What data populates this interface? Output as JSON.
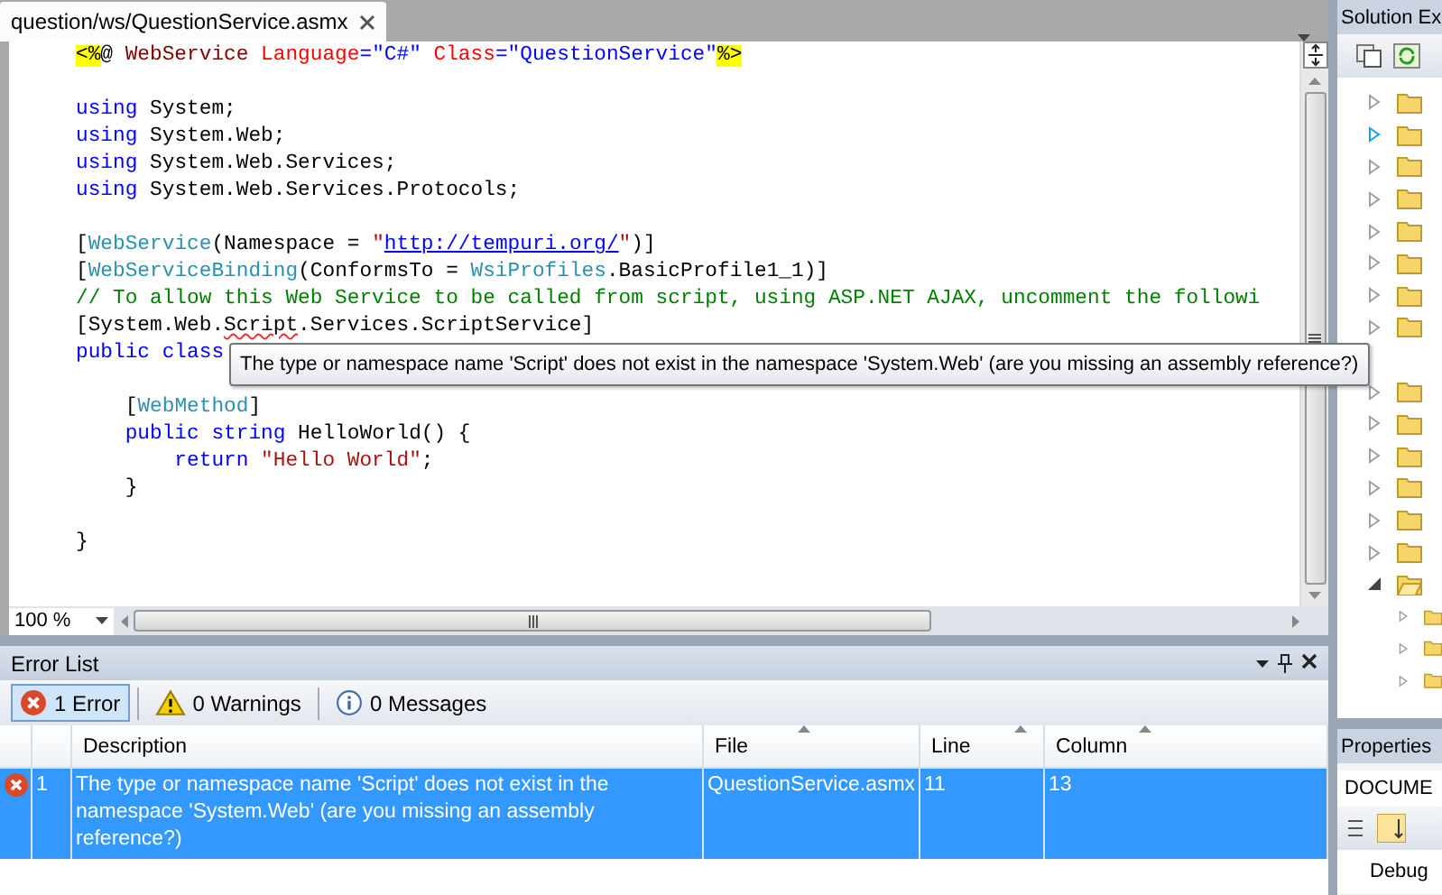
{
  "editor": {
    "tab": {
      "title": "question/ws/QuestionService.asmx",
      "selected": true
    },
    "lines": [
      {
        "kind": "code",
        "tokens": [
          {
            "kind": "hl",
            "text": "<%"
          },
          {
            "kind": "plain",
            "text": "@ "
          },
          {
            "kind": "el",
            "text": "WebService"
          },
          {
            "kind": "attr",
            "text": " Language"
          },
          {
            "kind": "val",
            "text": "=\"C#\""
          },
          {
            "kind": "attr",
            "text": " Class"
          },
          {
            "kind": "val",
            "text": "=\"QuestionService\""
          },
          {
            "kind": "hl",
            "text": "%>"
          }
        ]
      },
      {
        "kind": "blank"
      },
      {
        "kind": "code",
        "tokens": [
          {
            "kind": "kw",
            "text": "using"
          },
          {
            "kind": "plain",
            "text": " System;"
          }
        ]
      },
      {
        "kind": "code",
        "tokens": [
          {
            "kind": "kw",
            "text": "using"
          },
          {
            "kind": "plain",
            "text": " System.Web;"
          }
        ]
      },
      {
        "kind": "code",
        "tokens": [
          {
            "kind": "kw",
            "text": "using"
          },
          {
            "kind": "plain",
            "text": " System.Web.Services;"
          }
        ]
      },
      {
        "kind": "code",
        "tokens": [
          {
            "kind": "kw",
            "text": "using"
          },
          {
            "kind": "plain",
            "text": " System.Web.Services.Protocols;"
          }
        ]
      },
      {
        "kind": "blank"
      },
      {
        "kind": "code",
        "tokens": [
          {
            "kind": "plain",
            "text": "["
          },
          {
            "kind": "type",
            "text": "WebService"
          },
          {
            "kind": "plain",
            "text": "(Namespace = "
          },
          {
            "kind": "str",
            "text": "\""
          },
          {
            "kind": "link",
            "text": "http://tempuri.org/"
          },
          {
            "kind": "str",
            "text": "\""
          },
          {
            "kind": "plain",
            "text": ")]"
          }
        ]
      },
      {
        "kind": "code",
        "tokens": [
          {
            "kind": "plain",
            "text": "["
          },
          {
            "kind": "type",
            "text": "WebServiceBinding"
          },
          {
            "kind": "plain",
            "text": "(ConformsTo = "
          },
          {
            "kind": "type",
            "text": "WsiProfiles"
          },
          {
            "kind": "plain",
            "text": ".BasicProfile1_1)]"
          }
        ]
      },
      {
        "kind": "code",
        "tokens": [
          {
            "kind": "comment",
            "text": "// To allow this Web Service to be called from script, using ASP.NET AJAX, uncomment the followi"
          }
        ]
      },
      {
        "kind": "code",
        "tokens": [
          {
            "kind": "plain",
            "text": "[System.Web."
          },
          {
            "kind": "err",
            "text": "Script"
          },
          {
            "kind": "plain",
            "text": ".Services.ScriptService]"
          }
        ]
      },
      {
        "kind": "code",
        "tokens": [
          {
            "kind": "kw",
            "text": "public class"
          }
        ]
      },
      {
        "kind": "blank"
      },
      {
        "kind": "code",
        "tokens": [
          {
            "kind": "plain",
            "text": "    ["
          },
          {
            "kind": "type",
            "text": "WebMethod"
          },
          {
            "kind": "plain",
            "text": "]"
          }
        ]
      },
      {
        "kind": "code",
        "tokens": [
          {
            "kind": "kw",
            "text": "    public string"
          },
          {
            "kind": "plain",
            "text": " HelloWorld() {"
          }
        ]
      },
      {
        "kind": "code",
        "tokens": [
          {
            "kind": "kw",
            "text": "        return"
          },
          {
            "kind": "str",
            "text": " \"Hello World\""
          },
          {
            "kind": "plain",
            "text": ";"
          }
        ]
      },
      {
        "kind": "code",
        "tokens": [
          {
            "kind": "plain",
            "text": "    }"
          }
        ]
      },
      {
        "kind": "blank"
      },
      {
        "kind": "code",
        "tokens": [
          {
            "kind": "plain",
            "text": "}"
          }
        ]
      }
    ],
    "zoom": "100 %",
    "tooltip": "The type or namespace name 'Script' does not exist in the namespace 'System.Web' (are you missing an assembly reference?)"
  },
  "error_list": {
    "title": "Error List",
    "filters": [
      {
        "kind": "error",
        "label": "1 Error",
        "selected": true
      },
      {
        "kind": "warning",
        "label": "0 Warnings",
        "selected": false
      },
      {
        "kind": "info",
        "label": "0 Messages",
        "selected": false
      }
    ],
    "columns": [
      {
        "label": "Description",
        "sort_caret": false
      },
      {
        "label": "File",
        "sort_caret": true
      },
      {
        "label": "Line",
        "sort_caret": true
      },
      {
        "label": "Column",
        "sort_caret": true
      }
    ],
    "rows": [
      {
        "kind": "error",
        "number": "1",
        "description": "The type or namespace name 'Script' does not exist in the namespace 'System.Web' (are you missing an assembly reference?)",
        "file": "QuestionService.asmx",
        "line": "11",
        "column": "13",
        "selected": true
      }
    ]
  },
  "solution_explorer": {
    "title": "Solution Ex",
    "tree": [
      {
        "expanded": false,
        "hovered": false
      },
      {
        "expanded": false,
        "hovered": true
      },
      {
        "expanded": false,
        "hovered": false
      },
      {
        "expanded": false,
        "hovered": false
      },
      {
        "expanded": false,
        "hovered": false
      },
      {
        "expanded": false,
        "hovered": false
      },
      {
        "expanded": false,
        "hovered": false
      },
      {
        "expanded": false,
        "hovered": false
      },
      {
        "expanded": false,
        "hovered": false
      },
      {
        "expanded": false,
        "hovered": false
      },
      {
        "expanded": false,
        "hovered": false
      },
      {
        "expanded": false,
        "hovered": false
      },
      {
        "expanded": false,
        "hovered": false
      },
      {
        "expanded": false,
        "hovered": false
      },
      {
        "expanded": true,
        "hovered": false,
        "children": [
          {
            "expanded": false,
            "hovered": false
          },
          {
            "expanded": false,
            "hovered": false
          },
          {
            "expanded": false,
            "hovered": false
          }
        ]
      }
    ]
  },
  "properties": {
    "title": "Properties",
    "object": "DOCUME",
    "row": "Debug"
  }
}
